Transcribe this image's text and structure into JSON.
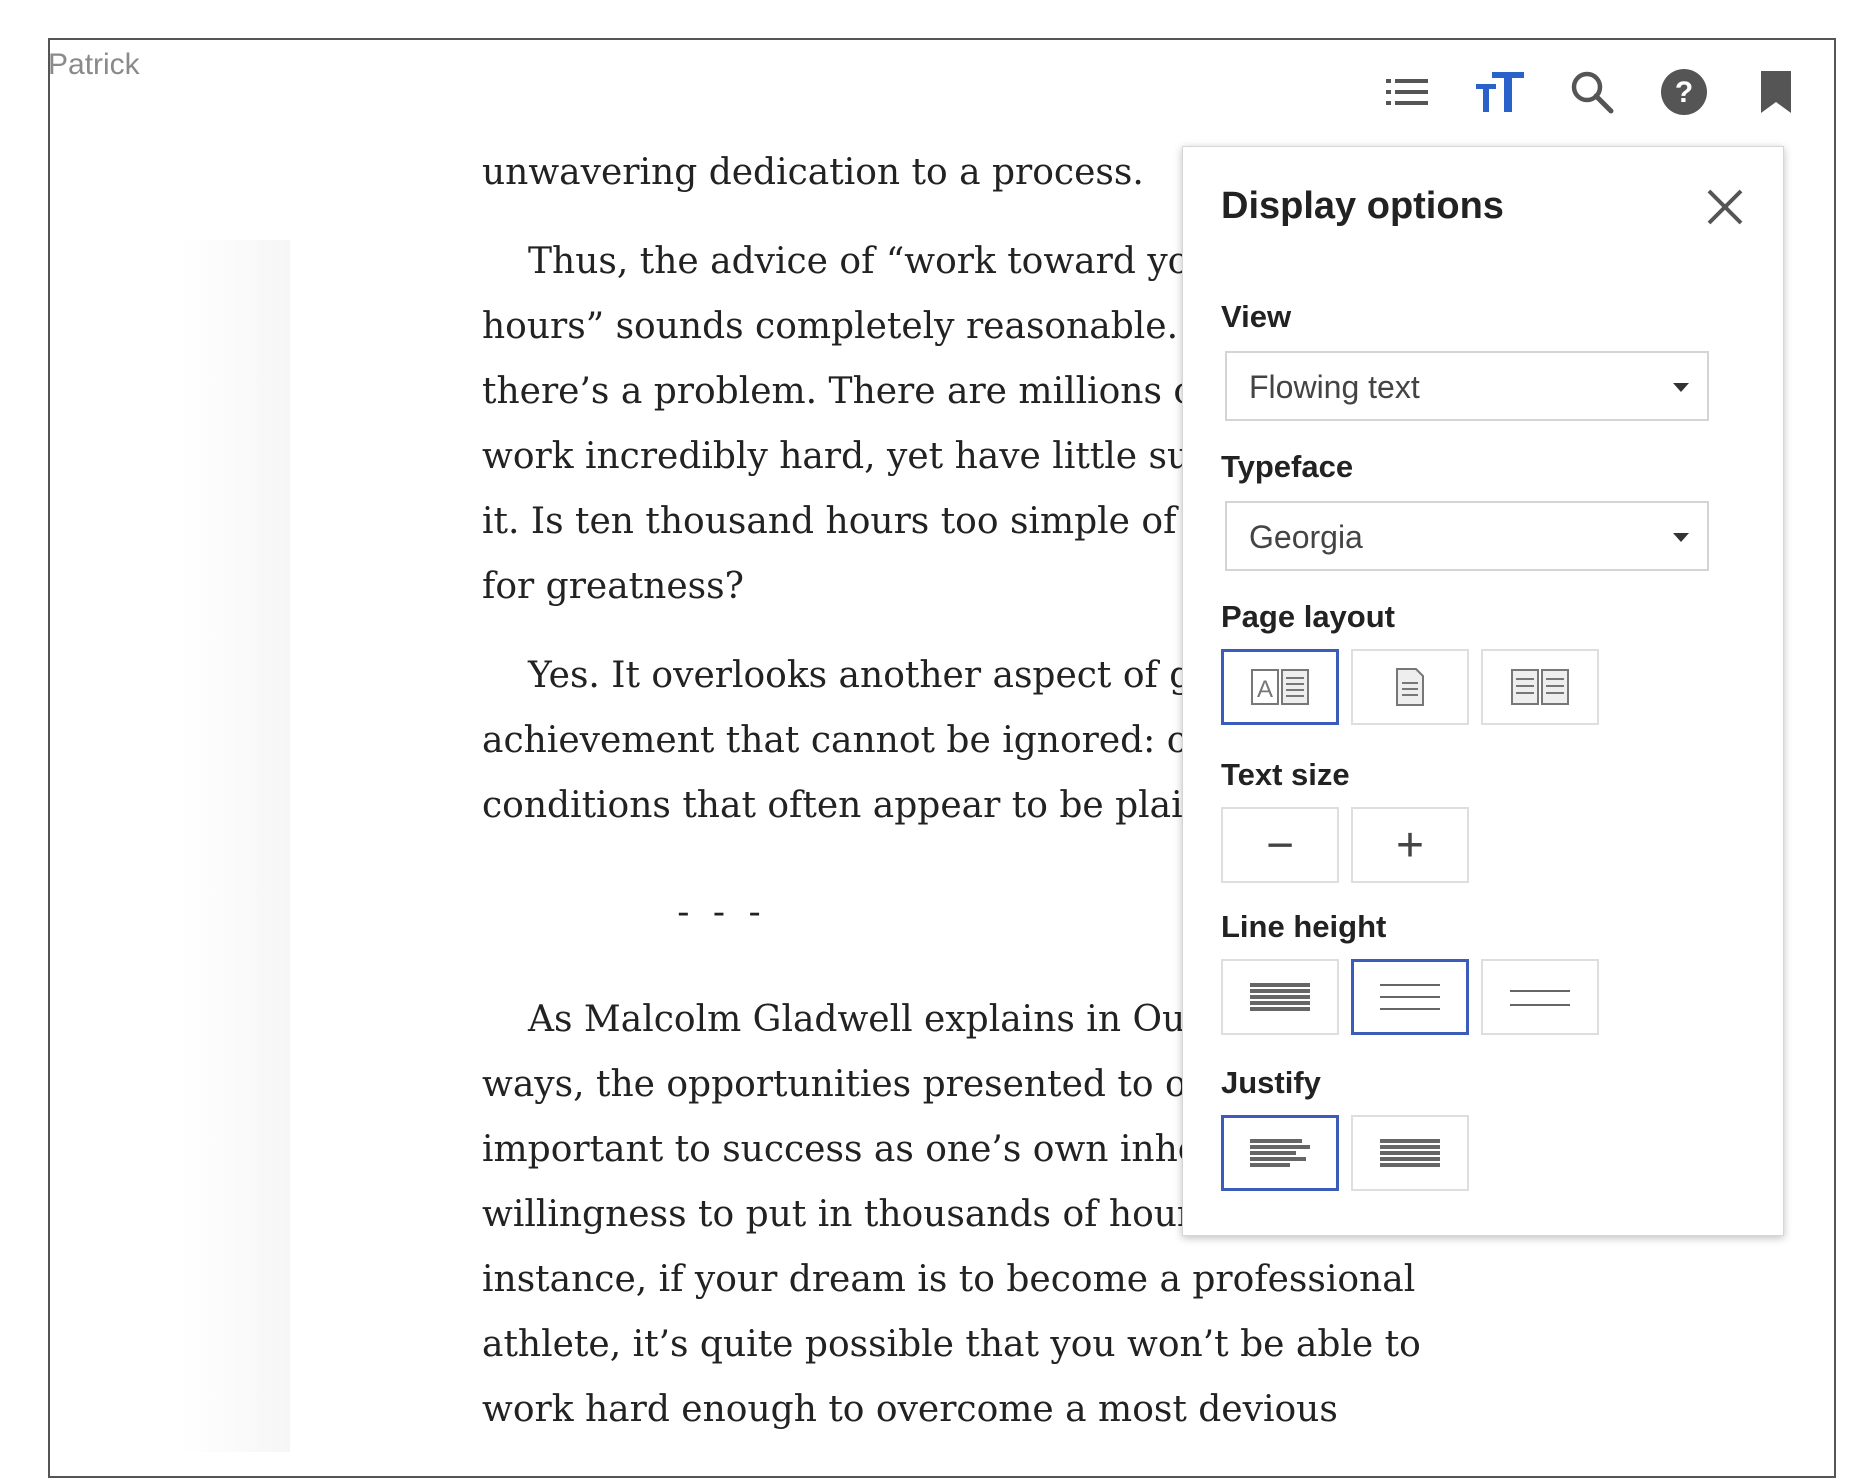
{
  "window": {
    "title": "Patrick"
  },
  "toolbar": {
    "items": [
      {
        "name": "contents",
        "icon": "list-icon"
      },
      {
        "name": "display-options",
        "icon": "text-size-icon",
        "active": true
      },
      {
        "name": "search",
        "icon": "search-icon"
      },
      {
        "name": "help",
        "icon": "help-icon"
      },
      {
        "name": "bookmark",
        "icon": "bookmark-icon"
      }
    ],
    "active_color": "#2a62c9",
    "icon_color": "#555555"
  },
  "book": {
    "lines": [
      "unwavering dedication to a process.",
      "Thus, the advice of “work toward your",
      "hours” sounds completely reasonable. Ri",
      "there’s a problem. There are millions of p",
      "work incredibly hard, yet have little succe",
      "it. Is ten thousand hours too simple of a p",
      "for greatness?",
      "Yes. It overlooks another aspect of grea",
      "achievement that cannot be ignored: opp",
      "conditions that often appear to be plain o",
      "- - -",
      "As Malcolm Gladwell explains in Outli",
      "ways, the opportunities presented to one",
      "important to success as one’s own inhere",
      "willingness to put in thousands of hours o",
      "instance, if your dream is to become a professional",
      "athlete, it’s quite possible that you won’t be able to",
      "work hard enough to overcome a most devious"
    ]
  },
  "panel": {
    "title": "Display options",
    "view": {
      "label": "View",
      "value": "Flowing text"
    },
    "typeface": {
      "label": "Typeface",
      "value": "Georgia"
    },
    "page_layout": {
      "label": "Page layout",
      "selected": 0,
      "options": [
        "auto-layout",
        "single-page",
        "two-page"
      ]
    },
    "text_size": {
      "label": "Text size",
      "decrease": "−",
      "increase": "+"
    },
    "line_height": {
      "label": "Line height",
      "selected": 1,
      "options": [
        "compact",
        "normal",
        "loose"
      ]
    },
    "justify": {
      "label": "Justify",
      "selected": 0,
      "options": [
        "left-aligned",
        "justified"
      ]
    },
    "selected_color": "#3b5cb8"
  }
}
